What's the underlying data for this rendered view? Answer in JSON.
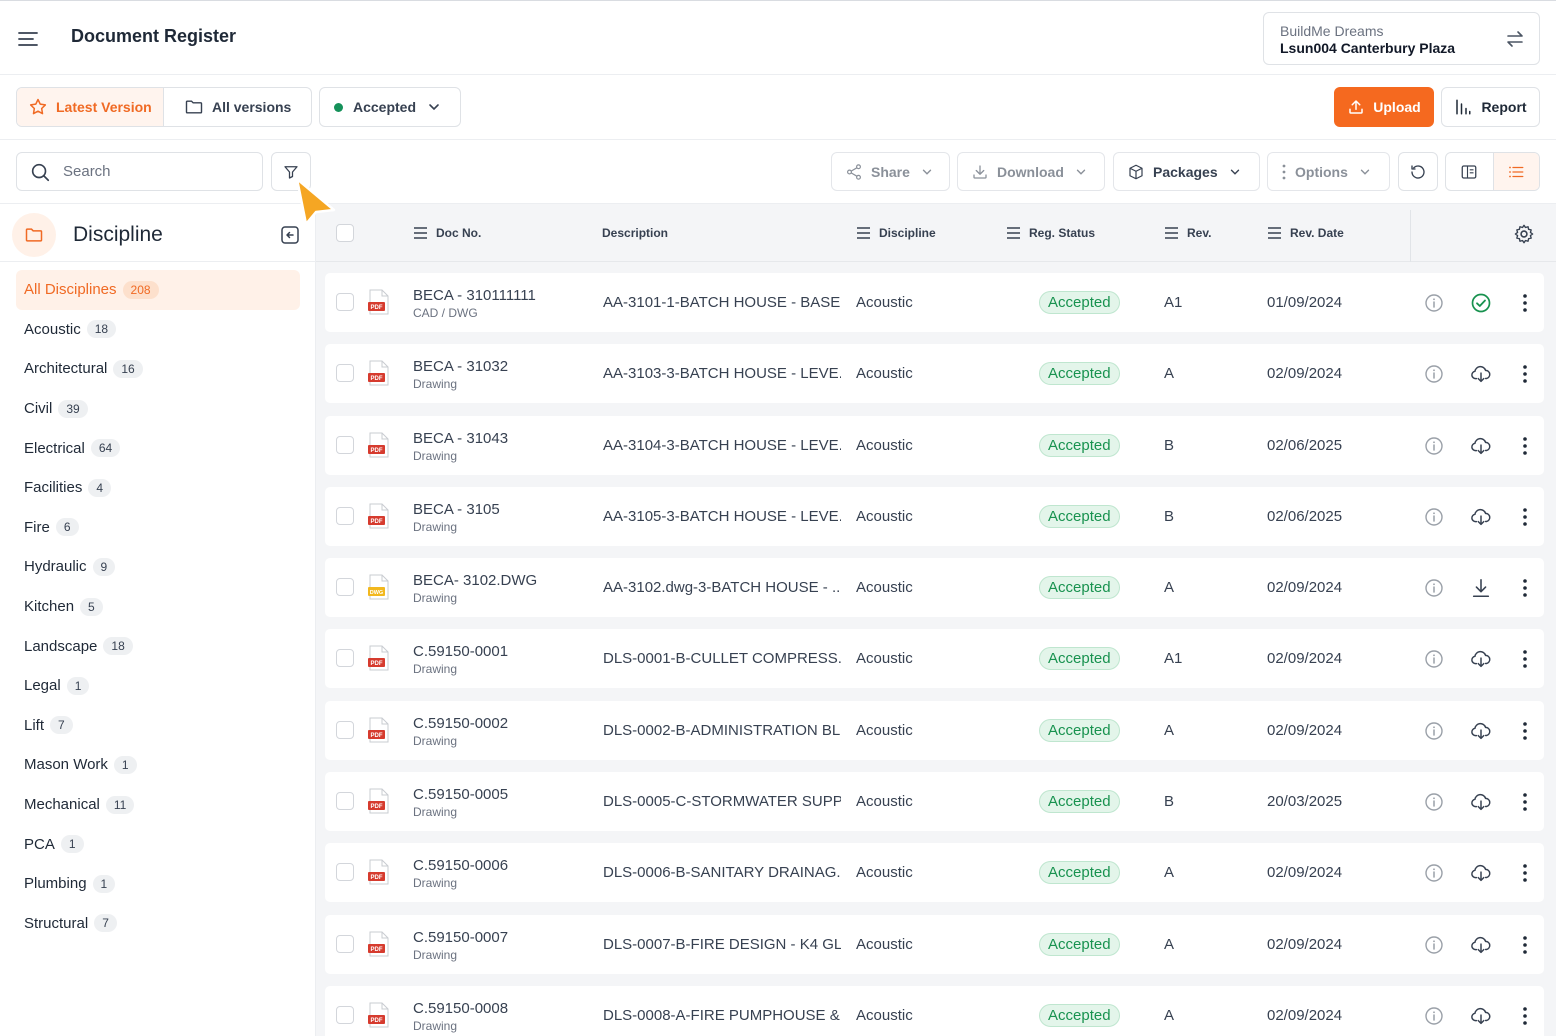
{
  "header": {
    "title": "Document Register",
    "org": "BuildMe Dreams",
    "project": "Lsun004 Canterbury Plaza"
  },
  "version_bar": {
    "latest_label": "Latest Version",
    "all_label": "All versions",
    "status_filter": "Accepted",
    "upload_label": "Upload",
    "report_label": "Report"
  },
  "actions": {
    "search_placeholder": "Search",
    "share_label": "Share",
    "download_label": "Download",
    "packages_label": "Packages",
    "options_label": "Options"
  },
  "sidebar": {
    "title": "Discipline",
    "items": [
      {
        "label": "All Disciplines",
        "count": "208",
        "active": true
      },
      {
        "label": "Acoustic",
        "count": "18"
      },
      {
        "label": "Architectural",
        "count": "16"
      },
      {
        "label": "Civil",
        "count": "39"
      },
      {
        "label": "Electrical",
        "count": "64"
      },
      {
        "label": "Facilities",
        "count": "4"
      },
      {
        "label": "Fire",
        "count": "6"
      },
      {
        "label": "Hydraulic",
        "count": "9"
      },
      {
        "label": "Kitchen",
        "count": "5"
      },
      {
        "label": "Landscape",
        "count": "18"
      },
      {
        "label": "Legal",
        "count": "1"
      },
      {
        "label": "Lift",
        "count": "7"
      },
      {
        "label": "Mason Work",
        "count": "1"
      },
      {
        "label": "Mechanical",
        "count": "11"
      },
      {
        "label": "PCA",
        "count": "1"
      },
      {
        "label": "Plumbing",
        "count": "1"
      },
      {
        "label": "Structural",
        "count": "7"
      }
    ]
  },
  "table": {
    "columns": {
      "doc_no": "Doc No.",
      "description": "Description",
      "discipline": "Discipline",
      "status": "Reg. Status",
      "rev": "Rev.",
      "rev_date": "Rev. Date"
    },
    "rows": [
      {
        "doc_no": "BECA - 310111111",
        "type": "CAD / DWG",
        "file": "pdf",
        "description": "AA-3101-1-BATCH HOUSE - BASE...",
        "discipline": "Acoustic",
        "status": "Accepted",
        "rev": "A1",
        "rev_date": "01/09/2024",
        "action": "check-circle-icon"
      },
      {
        "doc_no": "BECA - 31032",
        "type": "Drawing",
        "file": "pdf",
        "description": "AA-3103-3-BATCH HOUSE - LEVE...",
        "discipline": "Acoustic",
        "status": "Accepted",
        "rev": "A",
        "rev_date": "02/09/2024",
        "action": "cloud-download-icon"
      },
      {
        "doc_no": "BECA - 31043",
        "type": "Drawing",
        "file": "pdf",
        "description": "AA-3104-3-BATCH HOUSE - LEVE...",
        "discipline": "Acoustic",
        "status": "Accepted",
        "rev": "B",
        "rev_date": "02/06/2025",
        "action": "cloud-download-icon"
      },
      {
        "doc_no": "BECA - 3105",
        "type": "Drawing",
        "file": "pdf",
        "description": "AA-3105-3-BATCH HOUSE - LEVE...",
        "discipline": "Acoustic",
        "status": "Accepted",
        "rev": "B",
        "rev_date": "02/06/2025",
        "action": "cloud-download-icon"
      },
      {
        "doc_no": "BECA- 3102.DWG",
        "type": "Drawing",
        "file": "dwg",
        "description": "AA-3102.dwg-3-BATCH HOUSE - ...",
        "discipline": "Acoustic",
        "status": "Accepted",
        "rev": "A",
        "rev_date": "02/09/2024",
        "action": "download-icon"
      },
      {
        "doc_no": "C.59150-0001",
        "type": "Drawing",
        "file": "pdf",
        "description": "DLS-0001-B-CULLET COMPRESS...",
        "discipline": "Acoustic",
        "status": "Accepted",
        "rev": "A1",
        "rev_date": "02/09/2024",
        "action": "cloud-download-icon"
      },
      {
        "doc_no": "C.59150-0002",
        "type": "Drawing",
        "file": "pdf",
        "description": "DLS-0002-B-ADMINISTRATION BL...",
        "discipline": "Acoustic",
        "status": "Accepted",
        "rev": "A",
        "rev_date": "02/09/2024",
        "action": "cloud-download-icon"
      },
      {
        "doc_no": "C.59150-0005",
        "type": "Drawing",
        "file": "pdf",
        "description": "DLS-0005-C-STORMWATER SUPP...",
        "discipline": "Acoustic",
        "status": "Accepted",
        "rev": "B",
        "rev_date": "20/03/2025",
        "action": "cloud-download-icon"
      },
      {
        "doc_no": "C.59150-0006",
        "type": "Drawing",
        "file": "pdf",
        "description": "DLS-0006-B-SANITARY DRAINAG...",
        "discipline": "Acoustic",
        "status": "Accepted",
        "rev": "A",
        "rev_date": "02/09/2024",
        "action": "cloud-download-icon"
      },
      {
        "doc_no": "C.59150-0007",
        "type": "Drawing",
        "file": "pdf",
        "description": "DLS-0007-B-FIRE DESIGN - K4 GL...",
        "discipline": "Acoustic",
        "status": "Accepted",
        "rev": "A",
        "rev_date": "02/09/2024",
        "action": "cloud-download-icon"
      },
      {
        "doc_no": "C.59150-0008",
        "type": "Drawing",
        "file": "pdf",
        "description": "DLS-0008-A-FIRE PUMPHOUSE & ...",
        "discipline": "Acoustic",
        "status": "Accepted",
        "rev": "A",
        "rev_date": "02/09/2024",
        "action": "cloud-download-icon"
      }
    ]
  },
  "colors": {
    "brand": "#f5691f",
    "accepted": "#18924f",
    "pdf_red": "#d63b2e",
    "dwg_yellow": "#f2b81f"
  }
}
